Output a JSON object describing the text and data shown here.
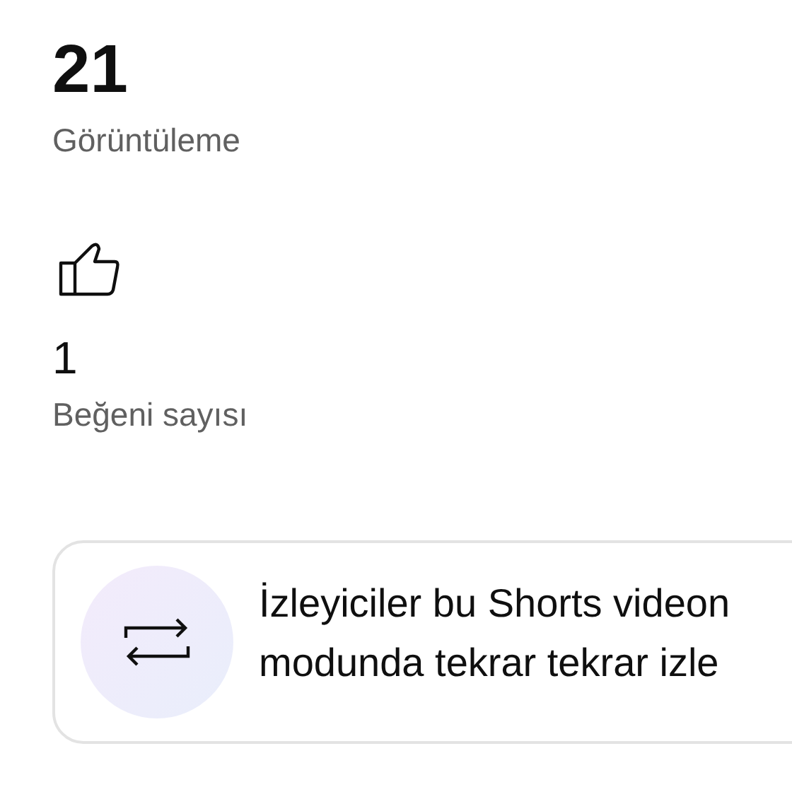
{
  "views": {
    "count": "21",
    "label": "Görüntüleme"
  },
  "likes": {
    "count": "1",
    "label": "Beğeni sayısı"
  },
  "info_card": {
    "lines": [
      "İzleyiciler bu Shorts videon",
      "modunda tekrar tekrar izle"
    ]
  }
}
